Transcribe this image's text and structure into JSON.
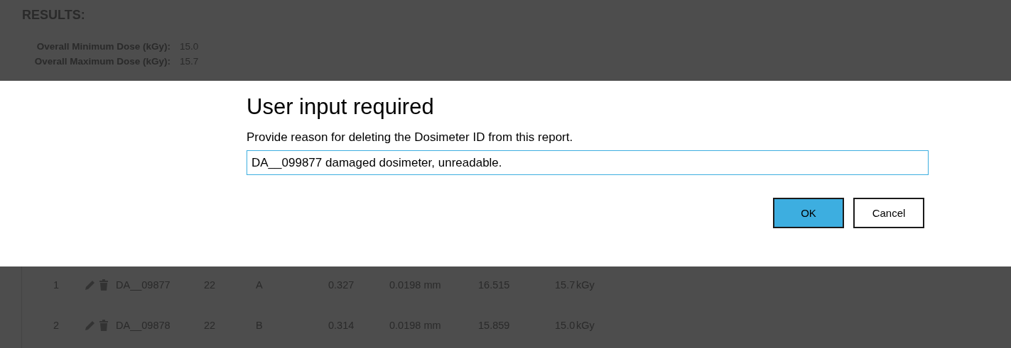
{
  "results": {
    "heading": "RESULTS:",
    "stats": [
      {
        "label": "Overall Minimum Dose (kGy):",
        "value": "15.0"
      },
      {
        "label": "Overall Maximum Dose (kGy):",
        "value": "15.7"
      }
    ]
  },
  "dialog": {
    "title": "User input required",
    "message": "Provide reason for deleting the Dosimeter ID from this report.",
    "input_value": "DA__099877 damaged dosimeter, unreadable.",
    "buttons": [
      {
        "label": "OK",
        "primary": true
      },
      {
        "label": "Cancel",
        "primary": false
      }
    ]
  },
  "table": {
    "rows": [
      {
        "index": "1",
        "id": "DA__09877",
        "column_3": "22",
        "column_4": "A",
        "column_5": "0.327",
        "column_6": "0.0198 mm",
        "column_7": "16.515",
        "dose": "15.7",
        "unit": "kGy"
      },
      {
        "index": "2",
        "id": "DA__09878",
        "column_3": "22",
        "column_4": "B",
        "column_5": "0.314",
        "column_6": "0.0198 mm",
        "column_7": "15.859",
        "dose": "15.0",
        "unit": "kGy"
      }
    ]
  }
}
